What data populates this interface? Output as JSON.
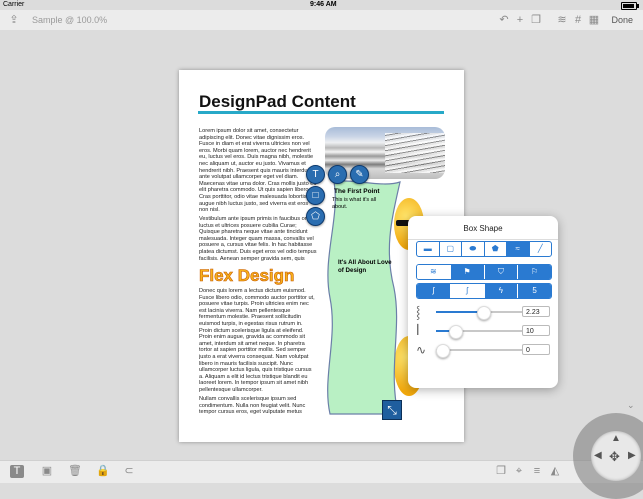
{
  "status_bar": {
    "carrier": "Carrier",
    "time": "9:46 AM"
  },
  "toolbar": {
    "title": "Sample @ 100.0%",
    "done_label": "Done"
  },
  "document": {
    "heading": "DesignPad Content",
    "col1_para1": "Lorem ipsum dolor sit amet, consectetur adipiscing elit. Donec vitae dignissim eros. Fusce in diam et erat viverra ultricies non vel eros. Morbi quam lorem, auctor nec hendrerit eu, luctus vel eros. Duis magna nibh, molestie nec aliquam ut, auctor eu justo. Vivamus et hendrerit nibh. Praesent quis mauris interdum ante volutpat ullamcorper eget vel diam. Maecenas vitae urna dolor. Cras mollis justo eu elit pharetra commodo. Ut quis sapien libero. Cras porttitor, odio vitae malesuada lobortis, augue nibh luctus justo, sed viverra est eros non nisl.",
    "col1_para2": "Vestibulum ante ipsum primis in faucibus orci luctus et ultrices posuere cubilia Curae; Quisque pharetra neque vitae ante tincidunt malesuada. Integer quam massa, convallis vel posuere a, cursus vitae felis. In hac habitasse platea dictumst. Duis eget eros vel odio tempus facilisis. Aenean semper gravida sem, quis aliquet enim tincidunt a. Donec vitae diam.",
    "subheading": "Flex Design",
    "col1_para3": "Donec quis lorem a lectus dictum euismod. Fusce libero odio, commodo auctor porttitor ut, posuere vitae turpis. Proin ultricies enim nec est lacinia viverra. Nam pellentesque fermentum molestie. Praesent sollicitudin euismod turpis, in egestas risus rutrum in. Proin dictum scelerisque ligula at eleifend. Proin enim augue, gravida ac commodo sit amet, interdum sit amet neque. In pharetra tortor at sapien porttitor mollis. Sed semper justo a erat viverra consequat. Nam volutpat libero in mauris facilisis suscipit. Nunc ullamcorper luctus ligula, quis tristique cursus a. Aliquam a elit id lectus tristique blandit eu laoreet lorem. In tempor ipsum sit amet nibh pellentesque ullamcorper.",
    "col1_para4": "Nullam convallis scelerisque ipsum sed condimentum. Nulla non feugiat velit. Nunc tempor cursus eros, eget vulputate metus",
    "shape_title": "The First Point",
    "shape_sub": "This is what it's all about.",
    "shape_body": "It's All About Love of Design"
  },
  "popover": {
    "title": "Box Shape",
    "row1_icons": [
      "rectangle",
      "rounded-rect",
      "ellipse",
      "pentagon",
      "wave",
      "line"
    ],
    "row2_icons": [
      "flag-left",
      "flag-wave",
      "banner",
      "flag-right"
    ],
    "row3_icons": [
      "wave-s",
      "wave-s-light",
      "zigzag",
      "wave-5"
    ],
    "sliders": [
      {
        "icon": "amplitude-icon",
        "value": "2.23",
        "level": 0.48
      },
      {
        "icon": "frequency-icon",
        "value": "10",
        "level": 0.2
      },
      {
        "icon": "phase-icon",
        "value": "0",
        "level": 0.0
      }
    ]
  },
  "colors": {
    "accent": "#2a7ad1",
    "shape_fill": "#b9f0c4",
    "shape_stroke": "#6b7fa8",
    "heading_rule": "#27a9c8",
    "flex_fill": "#f7b21b"
  }
}
